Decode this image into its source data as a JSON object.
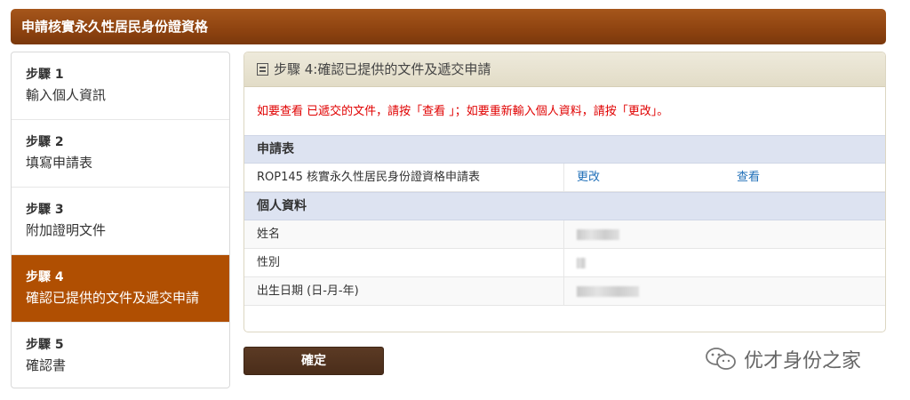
{
  "banner": {
    "title": "申請核實永久性居民身份證資格"
  },
  "sidebar": {
    "steps": [
      {
        "num": "步驟 1",
        "label": "輸入個人資訊"
      },
      {
        "num": "步驟 2",
        "label": "填寫申請表"
      },
      {
        "num": "步驟 3",
        "label": "附加證明文件"
      },
      {
        "num": "步驟 4",
        "label": "確認已提供的文件及遞交申請"
      },
      {
        "num": "步驟 5",
        "label": "確認書"
      }
    ],
    "active_index": 3
  },
  "panel": {
    "title": "步驟 4:確認已提供的文件及遞交申請",
    "notice": "如要查看 已遞交的文件，請按「查看 」；如要重新輸入個人資料，請按「更改」。",
    "form_section": {
      "heading": "申請表",
      "row": {
        "name": "ROP145 核實永久性居民身份證資格申請表",
        "edit_label": "更改",
        "view_label": "查看"
      }
    },
    "personal_section": {
      "heading": "個人資料",
      "fields": [
        {
          "label": "姓名"
        },
        {
          "label": "性別"
        },
        {
          "label": "出生日期 (日-月-年)"
        }
      ]
    }
  },
  "confirm_button": {
    "label": "確定"
  },
  "watermark": {
    "text": "优才身份之家"
  }
}
